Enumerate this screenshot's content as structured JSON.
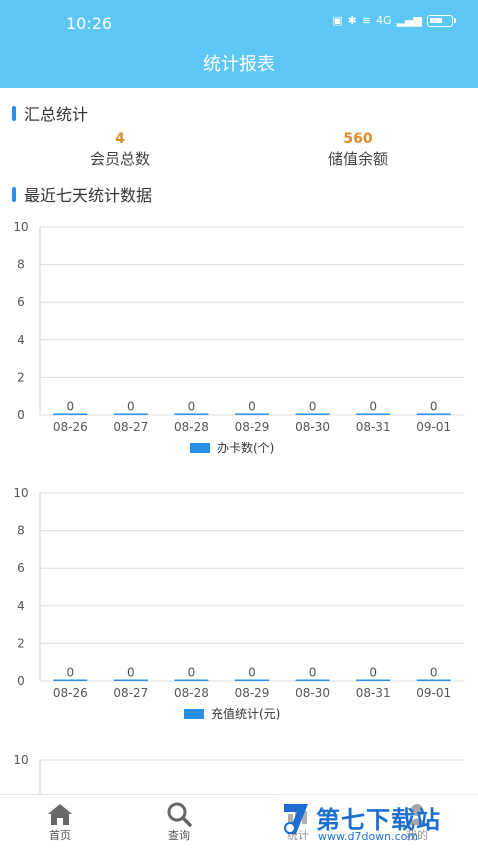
{
  "status": {
    "time": "10:26",
    "signal": "4G"
  },
  "page_title": "统计报表",
  "summary_section": {
    "title": "汇总统计"
  },
  "summary": [
    {
      "value": "4",
      "label": "会员总数"
    },
    {
      "value": "560",
      "label": "储值余额"
    }
  ],
  "recent_section": {
    "title": "最近七天统计数据"
  },
  "colors": {
    "header": "#5cc6f4",
    "accent": "#2a8fe6",
    "value": "#e08a2a"
  },
  "chart_data": [
    {
      "type": "bar",
      "categories": [
        "08-26",
        "08-27",
        "08-28",
        "08-29",
        "08-30",
        "08-31",
        "09-01"
      ],
      "series": [
        {
          "name": "办卡数(个)",
          "values": [
            0,
            0,
            0,
            0,
            0,
            0,
            0
          ]
        }
      ],
      "ylim": [
        0,
        10
      ],
      "yticks": [
        0,
        2,
        4,
        6,
        8,
        10
      ],
      "grid": true,
      "legend": "bottom-center"
    },
    {
      "type": "bar",
      "categories": [
        "08-26",
        "08-27",
        "08-28",
        "08-29",
        "08-30",
        "08-31",
        "09-01"
      ],
      "series": [
        {
          "name": "充值统计(元)",
          "values": [
            0,
            0,
            0,
            0,
            0,
            0,
            0
          ]
        }
      ],
      "ylim": [
        0,
        10
      ],
      "yticks": [
        0,
        2,
        4,
        6,
        8,
        10
      ],
      "grid": true,
      "legend": "bottom-center"
    },
    {
      "type": "bar",
      "categories": [],
      "series": [],
      "ylim": [
        0,
        10
      ],
      "yticks": [
        10
      ],
      "grid": true
    }
  ],
  "bottom_nav": [
    {
      "label": "首页",
      "icon": "home-icon"
    },
    {
      "label": "查询",
      "icon": "search-icon"
    },
    {
      "label": "统计",
      "icon": "chart-icon"
    },
    {
      "label": "我的",
      "icon": "user-icon"
    }
  ],
  "watermark": {
    "main": "第七下载站",
    "sub": "www.d7down.com"
  }
}
